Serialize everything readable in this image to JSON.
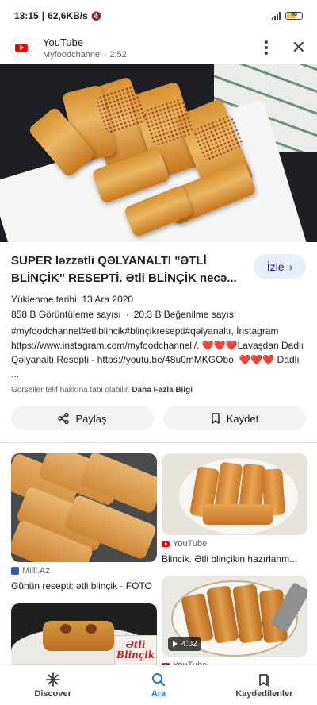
{
  "status_bar": {
    "time": "13:15",
    "network_speed": "62,6KB/s",
    "battery": "30"
  },
  "header": {
    "source_name": "YouTube",
    "source_sub": "Myfoodchannel · 2:52"
  },
  "hero": {
    "icons": [
      "lens-icon"
    ]
  },
  "title": "SUPER ləzzətli QƏLYANALTI \"ƏTLİ BLİNÇİK\" RESEPTİ. Ətli BLİNÇİK necə...",
  "visit_label": "İzle",
  "meta": {
    "date": "Yüklenme tarihi: 13 Ara 2020",
    "views": "858 B Görüntüleme sayısı",
    "separator": "·",
    "likes": "20,3 B Beğenilme sayısı"
  },
  "description": {
    "part1": "#myfoodchannel#etliblincik#blinçikresepti#qəlyanaltı, İnstagram https://www.instagram.com/myfoodchannell/, ",
    "hearts1": "❤️❤️❤️",
    "part2": "Lavaşdan Dadlı Qəlyanaltı Resepti - https://youtu.be/48u0mMKGObo, ",
    "hearts2": "❤️❤️❤️",
    "part3": " Dadlı ..."
  },
  "copyright": {
    "text": "Görseller telif hakkına tabi olabilir.",
    "link": "Daha Fazla Bilgi"
  },
  "actions": {
    "share": "Paylaş",
    "save": "Kaydet"
  },
  "related": [
    {
      "source": "Milli.Az",
      "title": "Günün resepti: ətli blinçik - FOTO"
    },
    {
      "source": "YouTube",
      "title": "Blincik. Ətli blinçikin hazırlanm..."
    },
    {
      "source": "",
      "title": "",
      "overlay": "Ətli Blinçik"
    },
    {
      "source": "YouTube",
      "title": "",
      "duration": "4:02"
    }
  ],
  "bottom_nav": {
    "discover": "Discover",
    "search": "Ara",
    "saved": "Kaydedilenler"
  },
  "colors": {
    "accent": "#1a73e8",
    "youtube_red": "#ff0000",
    "chip_bg": "#e8f0fe"
  }
}
